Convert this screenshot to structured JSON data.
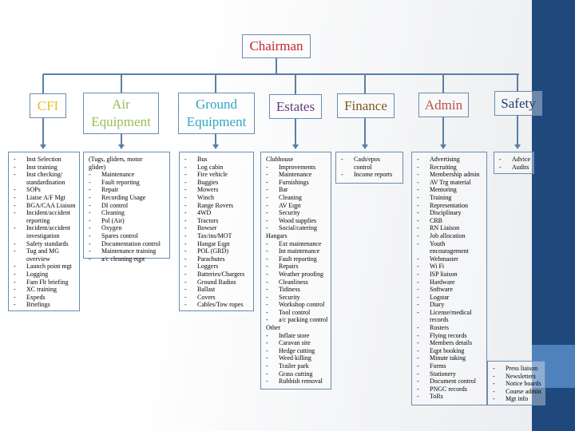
{
  "chairman": "Chairman",
  "colors": {
    "chairman": "#c0282d",
    "cfi": "#e6c229",
    "air": "#9bbb59",
    "ground": "#31a5c4",
    "estates": "#6b3b7a",
    "finance": "#7f5a1e",
    "admin": "#c0504d",
    "safety": "#1f3f6a",
    "line": "#5b7ea6",
    "strip": "#1f497d",
    "band": "#4f81bd"
  },
  "departments": [
    {
      "title": "CFI",
      "items": [
        {
          "t": "Inst Selection",
          "b": true
        },
        {
          "t": "Inst training",
          "b": true
        },
        {
          "t": "Inst checking/",
          "b": true
        },
        {
          "t": "standardisation",
          "b": false
        },
        {
          "t": "SOPs",
          "b": true
        },
        {
          "t": "Liaise A/F Mgt",
          "b": true
        },
        {
          "t": "BGA/CAA Liaison",
          "b": true
        },
        {
          "t": "Incident/accident",
          "b": true
        },
        {
          "t": "reporting",
          "b": false
        },
        {
          "t": "Incident/accident",
          "b": true
        },
        {
          "t": "investigation",
          "b": false
        },
        {
          "t": "Safety standards",
          "b": true
        },
        {
          "t": "Tug and MG",
          "b": true
        },
        {
          "t": "overview",
          "b": false
        },
        {
          "t": "Launch point mgt",
          "b": true
        },
        {
          "t": "Logging",
          "b": true
        },
        {
          "t": "Fam Flt briefing",
          "b": true
        },
        {
          "t": "XC training",
          "b": true
        },
        {
          "t": "Expeds",
          "b": true
        },
        {
          "t": "Briefings",
          "b": true
        }
      ]
    },
    {
      "title": "Air Equipment",
      "items": [
        {
          "t": "(Tugs, gliders, motor",
          "b": false,
          "h": true
        },
        {
          "t": "glider)",
          "b": false,
          "h": true
        },
        {
          "t": "Maintenance",
          "b": true
        },
        {
          "t": "Fault reporting",
          "b": true
        },
        {
          "t": "Repair",
          "b": true
        },
        {
          "t": "Recording Usage",
          "b": true
        },
        {
          "t": "DI control",
          "b": true
        },
        {
          "t": "Cleaning",
          "b": true
        },
        {
          "t": "Pol (Air)",
          "b": true
        },
        {
          "t": "Oxygen",
          "b": true
        },
        {
          "t": "Spares control",
          "b": true
        },
        {
          "t": "Documentation control",
          "b": true
        },
        {
          "t": "Maintenance training",
          "b": true
        },
        {
          "t": "a/c cleaning eqpt",
          "b": true
        }
      ]
    },
    {
      "title": "Ground Equipment",
      "items": [
        {
          "t": "Bus",
          "b": true
        },
        {
          "t": "Log cabin",
          "b": true
        },
        {
          "t": "Fire vehicle",
          "b": true
        },
        {
          "t": "Buggies",
          "b": true
        },
        {
          "t": "Mowers",
          "b": true
        },
        {
          "t": "Winch",
          "b": true
        },
        {
          "t": "Range Rovers",
          "b": true
        },
        {
          "t": "4WD",
          "b": true
        },
        {
          "t": "Tractors",
          "b": true
        },
        {
          "t": "Bowser",
          "b": true
        },
        {
          "t": "Tax/ins/MOT",
          "b": true
        },
        {
          "t": "Hangar Eqpt",
          "b": true
        },
        {
          "t": "POL (GRD)",
          "b": true
        },
        {
          "t": "Parachutes",
          "b": true
        },
        {
          "t": "Loggers",
          "b": true
        },
        {
          "t": "Batteries/Chargers",
          "b": true
        },
        {
          "t": "Ground Radios",
          "b": true
        },
        {
          "t": "Ballast",
          "b": true
        },
        {
          "t": "Covers",
          "b": true
        },
        {
          "t": "Cables/Tow ropes",
          "b": true
        }
      ]
    },
    {
      "title": "Estates",
      "items": [
        {
          "t": "Clubhouse",
          "b": false,
          "h": true
        },
        {
          "t": "Improvements",
          "b": true
        },
        {
          "t": "Maintenance",
          "b": true
        },
        {
          "t": "Furnishings",
          "b": true
        },
        {
          "t": "Bar",
          "b": true
        },
        {
          "t": "Cleaning",
          "b": true
        },
        {
          "t": "AV Eqpt",
          "b": true
        },
        {
          "t": "Security",
          "b": true
        },
        {
          "t": "Wood supplies",
          "b": true
        },
        {
          "t": "Social/catering",
          "b": true
        },
        {
          "t": "Hangars",
          "b": false,
          "h": true
        },
        {
          "t": "Ext maintenance",
          "b": true
        },
        {
          "t": "Int maintenance",
          "b": true
        },
        {
          "t": "Fault reporting",
          "b": true
        },
        {
          "t": "Repairs",
          "b": true
        },
        {
          "t": "Weather proofing",
          "b": true
        },
        {
          "t": "Cleanliness",
          "b": true
        },
        {
          "t": "Tidiness",
          "b": true
        },
        {
          "t": "Security",
          "b": true
        },
        {
          "t": "Workshop control",
          "b": true
        },
        {
          "t": "Tool control",
          "b": true
        },
        {
          "t": "a/c packing control",
          "b": true
        },
        {
          "t": "Other",
          "b": false,
          "h": true
        },
        {
          "t": "Inflate store",
          "b": true
        },
        {
          "t": "Caravan site",
          "b": true
        },
        {
          "t": "Hedge cutting",
          "b": true
        },
        {
          "t": "Weed killing",
          "b": true
        },
        {
          "t": "Trailer park",
          "b": true
        },
        {
          "t": "Grass cutting",
          "b": true
        },
        {
          "t": "Rubbish removal",
          "b": true
        }
      ]
    },
    {
      "title": "Finance",
      "items": [
        {
          "t": "Cash/epos",
          "b": true
        },
        {
          "t": "control",
          "b": false
        },
        {
          "t": "Income reports",
          "b": true
        }
      ]
    },
    {
      "title": "Admin",
      "items": [
        {
          "t": "Advertising",
          "b": true
        },
        {
          "t": "Recruiting",
          "b": true
        },
        {
          "t": "Membership admin",
          "b": true
        },
        {
          "t": "AV Trg material",
          "b": true
        },
        {
          "t": "Mentoring",
          "b": true
        },
        {
          "t": "Training",
          "b": true
        },
        {
          "t": "Representation",
          "b": true
        },
        {
          "t": "Disciplinary",
          "b": true
        },
        {
          "t": "CRB",
          "b": true
        },
        {
          "t": "RN Liaison",
          "b": true
        },
        {
          "t": "Job allocation",
          "b": true
        },
        {
          "t": "Youth",
          "b": true
        },
        {
          "t": "encouragement",
          "b": false
        },
        {
          "t": "Webmaster",
          "b": true
        },
        {
          "t": "Wi Fi",
          "b": true
        },
        {
          "t": "ISP liaison",
          "b": true
        },
        {
          "t": "Hardware",
          "b": true
        },
        {
          "t": "Software",
          "b": true
        },
        {
          "t": "Logstar",
          "b": true
        },
        {
          "t": "Diary",
          "b": true
        },
        {
          "t": "License/medical",
          "b": true
        },
        {
          "t": "records",
          "b": false
        },
        {
          "t": "Rosters",
          "b": true
        },
        {
          "t": "Flying records",
          "b": true
        },
        {
          "t": "Members details",
          "b": true
        },
        {
          "t": "Eqpt booking",
          "b": true
        },
        {
          "t": "Minute taking",
          "b": true
        },
        {
          "t": "Forms",
          "b": true
        },
        {
          "t": "Stationery",
          "b": true
        },
        {
          "t": "Document control",
          "b": true
        },
        {
          "t": "PNGC records",
          "b": true
        },
        {
          "t": "ToRs",
          "b": true
        }
      ]
    },
    {
      "title": "Safety",
      "items": [
        {
          "t": "Advice",
          "b": true
        },
        {
          "t": "Audits",
          "b": true
        }
      ]
    }
  ],
  "extra_box": {
    "items": [
      {
        "t": "Press liaison",
        "b": true
      },
      {
        "t": "Newsletters",
        "b": true
      },
      {
        "t": "Notice boards",
        "b": true
      },
      {
        "t": "Course admin",
        "b": true
      },
      {
        "t": "Mgt info",
        "b": true
      }
    ]
  },
  "bullet": "-"
}
